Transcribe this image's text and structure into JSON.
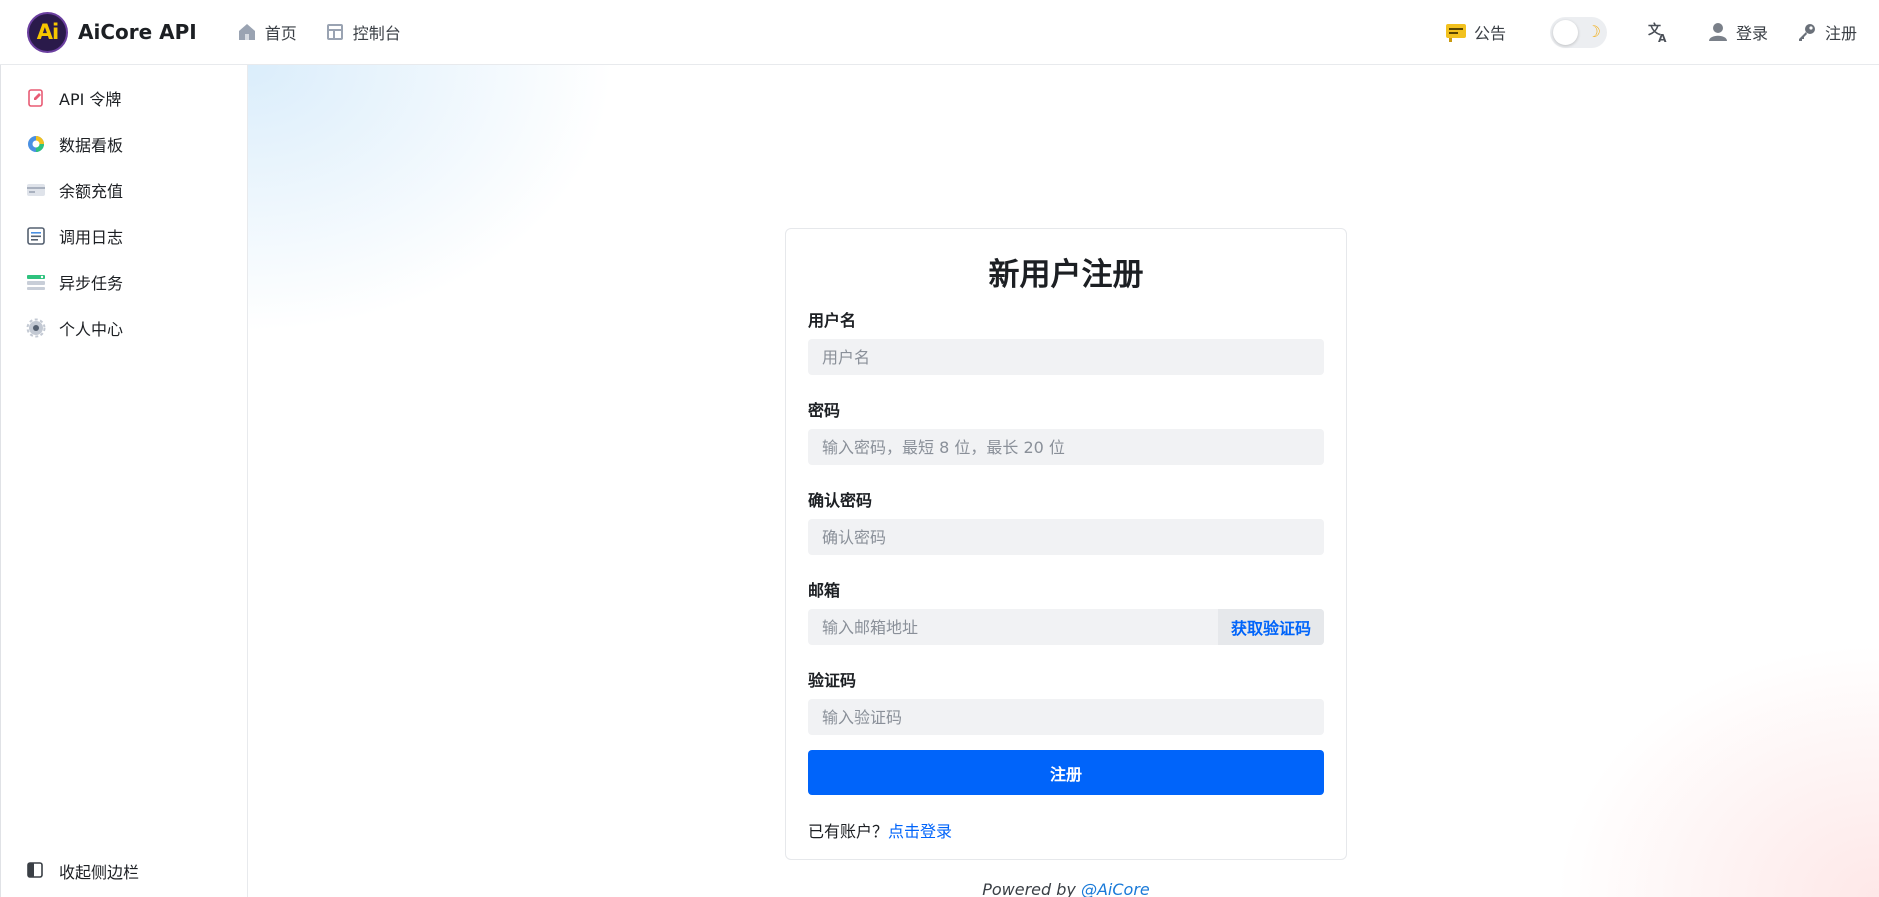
{
  "app": {
    "logo_text": "Ai",
    "name": "AiCore API"
  },
  "topnav": [
    {
      "label": "首页",
      "icon": "home-icon"
    },
    {
      "label": "控制台",
      "icon": "console-icon"
    }
  ],
  "header_right": {
    "notice_label": "公告",
    "theme_toggle_icon": "moon-icon",
    "login_label": "登录",
    "register_label": "注册"
  },
  "sidebar": {
    "items": [
      {
        "label": "API 令牌",
        "icon": "token-icon"
      },
      {
        "label": "数据看板",
        "icon": "chart-icon"
      },
      {
        "label": "余额充值",
        "icon": "card-icon"
      },
      {
        "label": "调用日志",
        "icon": "log-icon"
      },
      {
        "label": "异步任务",
        "icon": "task-icon"
      },
      {
        "label": "个人中心",
        "icon": "gear-icon"
      }
    ],
    "collapse_label": "收起侧边栏"
  },
  "form": {
    "title": "新用户注册",
    "username": {
      "label": "用户名",
      "placeholder": "用户名"
    },
    "password": {
      "label": "密码",
      "placeholder": "输入密码，最短 8 位，最长 20 位"
    },
    "confirm": {
      "label": "确认密码",
      "placeholder": "确认密码"
    },
    "email": {
      "label": "邮箱",
      "placeholder": "输入邮箱地址",
      "button": "获取验证码"
    },
    "code": {
      "label": "验证码",
      "placeholder": "输入验证码"
    },
    "submit": "注册",
    "login_hint": "已有账户？",
    "login_link": "点击登录"
  },
  "footer": {
    "powered_by": "Powered by ",
    "link": "@AiCore"
  },
  "colors": {
    "primary": "#0064fa",
    "input_bg": "#f1f2f4"
  }
}
